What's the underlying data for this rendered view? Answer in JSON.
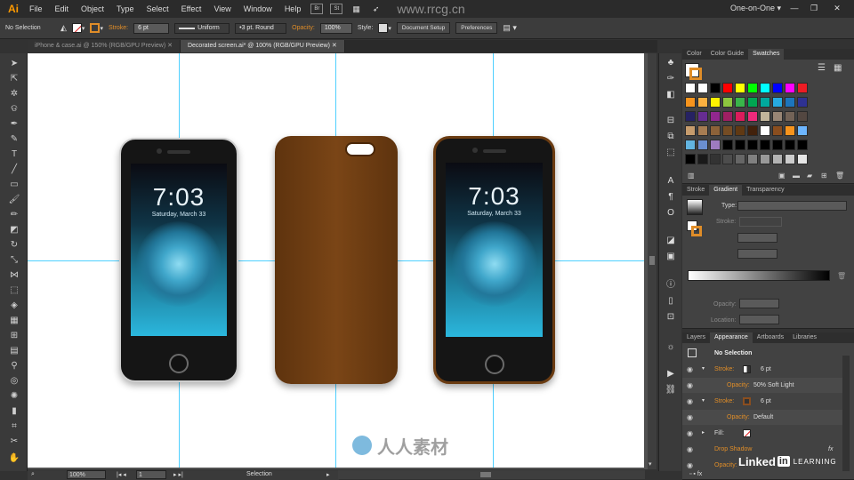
{
  "app": {
    "logo": "Ai",
    "workspace": "One-on-One ▾"
  },
  "menu": [
    "File",
    "Edit",
    "Object",
    "Type",
    "Select",
    "Effect",
    "View",
    "Window",
    "Help"
  ],
  "menu_badges": [
    "Br",
    "St"
  ],
  "window_controls": [
    "—",
    "❐",
    "✕"
  ],
  "control_bar": {
    "selection": "No Selection",
    "stroke_label": "Stroke:",
    "stroke_value": "6 pt",
    "uniform": "Uniform",
    "brush": "3 pt. Round",
    "opacity_label": "Opacity:",
    "opacity_value": "100%",
    "style_label": "Style:",
    "doc_setup": "Document Setup",
    "preferences": "Preferences"
  },
  "tabs": [
    {
      "label": "iPhone & case.ai @ 150% (RGB/GPU Preview)",
      "active": false
    },
    {
      "label": "Decorated screen.ai* @ 100% (RGB/GPU Preview)",
      "active": true
    }
  ],
  "phones": {
    "time": "7:03",
    "date": "Saturday, March 33"
  },
  "status": {
    "zoom": "100%",
    "artboard": "1",
    "mode": "Selection"
  },
  "swatch_panel": {
    "tabs": [
      "Color",
      "Color Guide",
      "Swatches"
    ],
    "colors": [
      [
        "#ffffff",
        "#ffffff",
        "#000000",
        "#ff0000",
        "#ffff00",
        "#00ff00",
        "#00ffff",
        "#0000ff",
        "#ff00ff",
        "#ed1c24"
      ],
      [
        "#f7941d",
        "#fbb040",
        "#fff200",
        "#8dc63f",
        "#39b54a",
        "#00a651",
        "#00a99d",
        "#27aae1",
        "#1c75bc",
        "#2e3192"
      ],
      [
        "#262262",
        "#662d91",
        "#92278f",
        "#9e1f63",
        "#da1c5c",
        "#ee2a7b",
        "#c2b59b",
        "#998675",
        "#736357",
        "#534741"
      ],
      [
        "#c69c6d",
        "#a67c52",
        "#8c6239",
        "#754c24",
        "#603913",
        "#42210b",
        "#ffffff",
        "#8a4e1f",
        "#f7941d",
        "#6db6ff"
      ],
      [
        "#62b4e0",
        "#6a8fd0",
        "#9e7bc0",
        "#000000",
        "#000000",
        "#000000",
        "#000000",
        "#000000",
        "#000000",
        "#000000"
      ],
      [
        "#000000",
        "#1a1a1a",
        "#333333",
        "#4d4d4d",
        "#666666",
        "#808080",
        "#999999",
        "#b3b3b3",
        "#cccccc",
        "#e6e6e6"
      ]
    ]
  },
  "gradient_panel": {
    "tabs": [
      "Stroke",
      "Gradient",
      "Transparency"
    ],
    "type_label": "Type:",
    "stroke_label": "Stroke:",
    "opacity_label": "Opacity:",
    "location_label": "Location:"
  },
  "appearance_panel": {
    "tabs": [
      "Layers",
      "Appearance",
      "Artboards",
      "Libraries"
    ],
    "header": "No Selection",
    "rows": [
      {
        "label": "Stroke:",
        "value": "6 pt",
        "sub": false
      },
      {
        "label": "Opacity:",
        "value": "50% Soft Light",
        "sub": true
      },
      {
        "label": "Stroke:",
        "value": "6 pt",
        "sub": false
      },
      {
        "label": "Opacity:",
        "value": "Default",
        "sub": true
      },
      {
        "label": "Fill:",
        "value": "",
        "sub": false
      },
      {
        "label": "Drop Shadow",
        "value": "",
        "sub": false
      },
      {
        "label": "Opacity:",
        "value": "",
        "sub": false
      }
    ],
    "fx": "fx"
  },
  "watermark": {
    "site": "www.rrcg.cn",
    "brand_cn": "人人素材",
    "linkedin": "Linked",
    "linkedin_in": "in",
    "learning": "LEARNING"
  },
  "colors": {
    "accent": "#e08d28",
    "guide": "#4fd0ff",
    "case_brown": "#6b3c12"
  }
}
